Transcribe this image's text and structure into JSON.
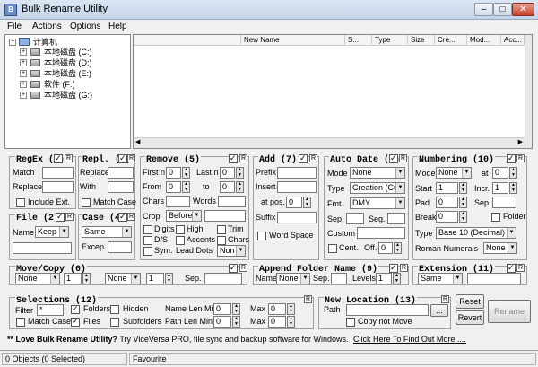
{
  "window": {
    "title": "Bulk Rename Utility",
    "min": "–",
    "max": "□",
    "close": "✕"
  },
  "menu": [
    "File",
    "Actions",
    "Options",
    "Help"
  ],
  "tree": {
    "root": "计算机",
    "drives": [
      "本地磁盘 (C:)",
      "本地磁盘 (D:)",
      "本地磁盘 (E:)",
      "软件 (F:)",
      "本地磁盘 (G:)"
    ]
  },
  "filelist": {
    "columns": [
      "New Name",
      "S...",
      "Type",
      "Size",
      "Cre...",
      "Mod...",
      "Acc..."
    ]
  },
  "regex": {
    "title": "RegEx (1)",
    "match": "Match",
    "replace": "Replace",
    "include_ext": "Include Ext."
  },
  "repl": {
    "title": "Repl. (3)",
    "replace": "Replace",
    "with": "With",
    "match_case": "Match Case"
  },
  "remove": {
    "title": "Remove (5)",
    "first_n": "First n",
    "first_n_val": "0",
    "last_n": "Last n",
    "last_n_val": "0",
    "from": "From",
    "from_val": "0",
    "to": "to",
    "to_val": "0",
    "chars": "Chars",
    "words": "Words",
    "crop": "Crop",
    "crop_val": "Before",
    "digits": "Digits",
    "high": "High",
    "trim": "Trim",
    "ds": "D/S",
    "accents": "Accents",
    "chars2": "Chars",
    "sym": "Sym.",
    "lead_dots": "Lead Dots",
    "lead_dots_val": "Non"
  },
  "add": {
    "title": "Add (7)",
    "prefix": "Prefix",
    "insert": "Insert",
    "at_pos": "at pos.",
    "at_pos_val": "0",
    "suffix": "Suffix",
    "word_space": "Word Space"
  },
  "autodate": {
    "title": "Auto Date (8)",
    "mode": "Mode",
    "mode_val": "None",
    "type": "Type",
    "type_val": "Creation (Cur",
    "fmt": "Fmt",
    "fmt_val": "DMY",
    "sep": "Sep.",
    "seg": "Seg.",
    "custom": "Custom",
    "cent": "Cent.",
    "off": "Off.",
    "off_val": "0"
  },
  "numbering": {
    "title": "Numbering (10)",
    "mode": "Mode",
    "mode_val": "None",
    "at": "at",
    "at_val": "0",
    "start": "Start",
    "start_val": "1",
    "incr": "Incr.",
    "incr_val": "1",
    "pad": "Pad",
    "pad_val": "0",
    "sep": "Sep.",
    "break": "Break",
    "break_val": "0",
    "folder": "Folder",
    "type": "Type",
    "type_val": "Base 10 (Decimal)",
    "roman": "Roman Numerals",
    "roman_val": "None"
  },
  "file": {
    "title": "File (2)",
    "name": "Name",
    "name_val": "Keep"
  },
  "case": {
    "title": "Case (4)",
    "case_val": "Same",
    "excep": "Excep."
  },
  "movecopy": {
    "title": "Move/Copy (6)",
    "dd1": "None",
    "dd1_num": "1",
    "dd2": "None",
    "dd2_num": "1",
    "sep": "Sep."
  },
  "appendfolder": {
    "title": "Append Folder Name (9)",
    "name": "Name",
    "name_val": "None",
    "sep": "Sep.",
    "levels": "Levels",
    "levels_val": "1"
  },
  "extension": {
    "title": "Extension (11)",
    "val": "Same"
  },
  "selections": {
    "title": "Selections (12)",
    "filter": "Filter",
    "filter_val": "*",
    "folders": "Folders",
    "hidden": "Hidden",
    "name_len_min": "Name Len Min",
    "name_len_min_val": "0",
    "max1": "Max",
    "max1_val": "0",
    "match_case": "Match Case",
    "files": "Files",
    "subfolders": "Subfolders",
    "path_len_min": "Path Len Min",
    "path_len_min_val": "0",
    "max2": "Max",
    "max2_val": "0"
  },
  "newlocation": {
    "title": "New Location (13)",
    "path": "Path",
    "browse": "...",
    "copy_not_move": "Copy not Move"
  },
  "buttons": {
    "reset": "Reset",
    "revert": "Revert",
    "rename": "Rename"
  },
  "promo": {
    "lead": "** Love Bulk Rename Utility?",
    "text": " Try ViceVersa PRO, file sync and backup software for Windows.",
    "link": "Click Here To Find Out More ...."
  },
  "status": {
    "objects": "0 Objects (0 Selected)",
    "favourite": "Favourite"
  },
  "r_label": "R"
}
